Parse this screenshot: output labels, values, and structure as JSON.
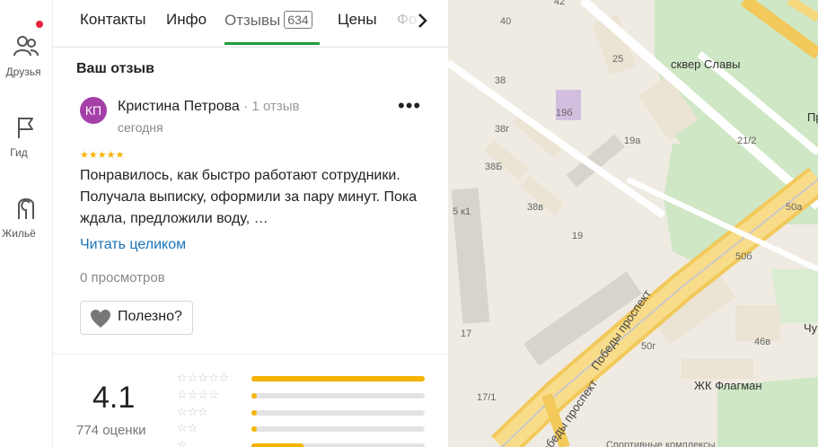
{
  "rail": {
    "friends_label": "Друзья",
    "guide_label": "Гид",
    "housing_label": "Жильё"
  },
  "tabs": [
    {
      "label": "Контакты"
    },
    {
      "label": "Инфо"
    },
    {
      "label": "Отзывы",
      "count": "634"
    },
    {
      "label": "Цены"
    },
    {
      "label": "Фо"
    }
  ],
  "section_title": "Ваш отзыв",
  "review": {
    "avatar_initials": "КП",
    "avatar_color": "#a43fa8",
    "author": "Кристина Петрова",
    "author_meta": "· 1 отзыв",
    "date": "сегодня",
    "stars": 5,
    "text": "Понравилось, как быстро работают сотрудники. Получала выписку, оформили за пару минут. Пока ждала, предложили воду, …",
    "read_more": "Читать целиком",
    "views": "0 просмотров",
    "useful_label": "Полезно?"
  },
  "rating": {
    "value": "4.1",
    "count_label": "774 оценки",
    "histogram": [
      {
        "stars": 5,
        "fraction": 1.0
      },
      {
        "stars": 4,
        "fraction": 0.03
      },
      {
        "stars": 3,
        "fraction": 0.03
      },
      {
        "stars": 2,
        "fraction": 0.03
      },
      {
        "stars": 1,
        "fraction": 0.3
      }
    ]
  },
  "map": {
    "labels": [
      "42",
      "40",
      "25",
      "38",
      "19б",
      "38г",
      "19а",
      "38Б",
      "5 к1",
      "38в",
      "19",
      "17",
      "17/1",
      "21/2",
      "50а",
      "50б",
      "50г",
      "46в",
      "сквер Славы",
      "Победы проспект",
      "Победы проспект",
      "ЖК Флагман",
      "Пр",
      "Чу",
      "Спортивные комплексы"
    ]
  },
  "colors": {
    "accent_green": "#1f9e3a",
    "star_yellow": "#f5b400",
    "link_blue": "#1a73b8",
    "notification_red": "#e8223b"
  }
}
